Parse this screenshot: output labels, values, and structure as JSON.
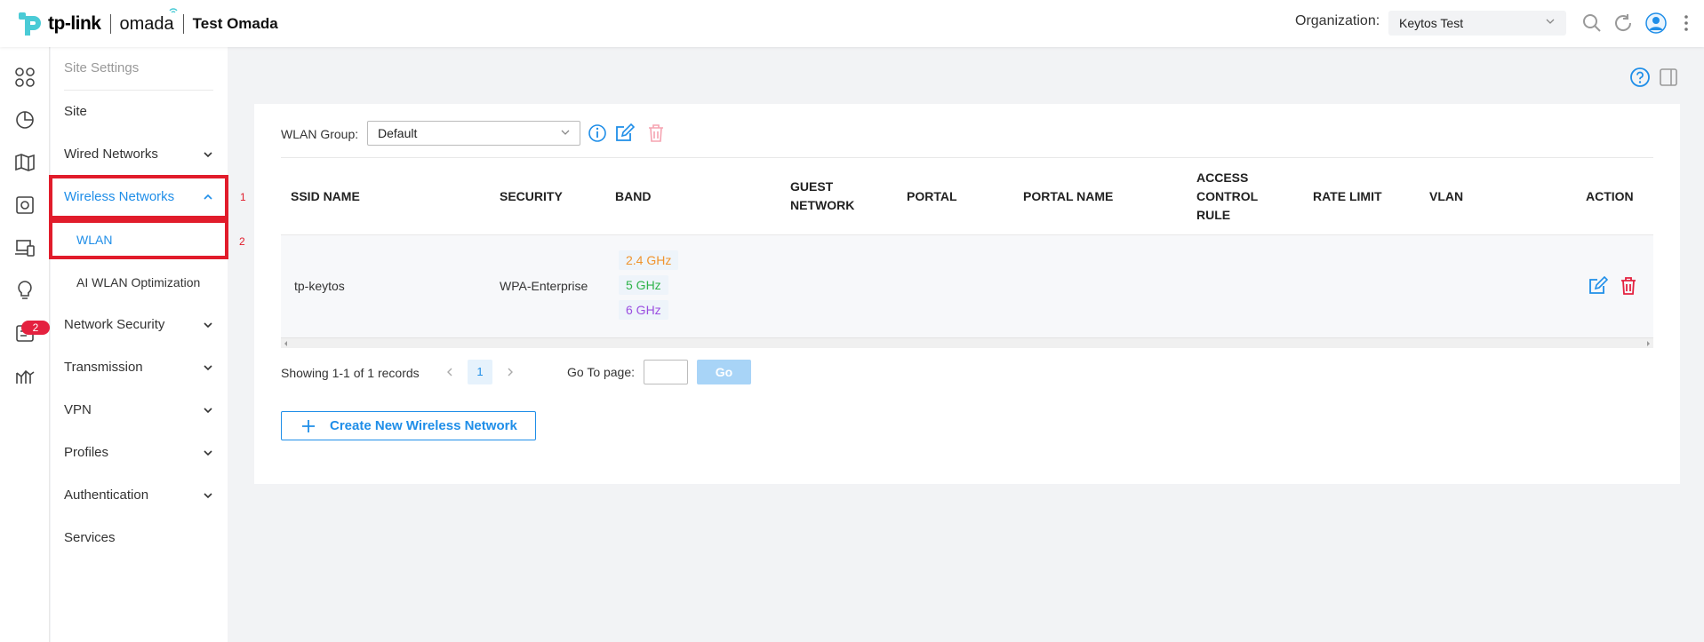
{
  "header": {
    "brand": "tp-link",
    "product": "omada",
    "app_title": "Test Omada",
    "org_label": "Organization:",
    "org_value": "Keytos Test"
  },
  "rail": {
    "badge_count": "2",
    "icons": [
      "dashboard-icon",
      "statistics-icon",
      "map-icon",
      "devices-icon",
      "clients-icon",
      "insights-icon",
      "logs-icon",
      "reports-icon"
    ]
  },
  "sidebar": {
    "heading": "Site Settings",
    "items": [
      {
        "label": "Site"
      },
      {
        "label": "Wired Networks"
      },
      {
        "label": "Wireless Networks"
      },
      {
        "label": "WLAN"
      },
      {
        "label": "AI WLAN Optimization"
      },
      {
        "label": "Network Security"
      },
      {
        "label": "Transmission"
      },
      {
        "label": "VPN"
      },
      {
        "label": "Profiles"
      },
      {
        "label": "Authentication"
      },
      {
        "label": "Services"
      }
    ],
    "annotations": [
      "1",
      "2"
    ]
  },
  "wlan_group": {
    "label": "WLAN Group",
    "selected": "Default"
  },
  "table": {
    "columns": {
      "ssid": "SSID NAME",
      "security": "SECURITY",
      "band": "BAND",
      "guest_1": "GUEST",
      "guest_2": "NETWORK",
      "portal": "PORTAL",
      "portal_name": "PORTAL NAME",
      "acr_1": "ACCESS",
      "acr_2": "CONTROL",
      "acr_3": "RULE",
      "rate_limit": "RATE LIMIT",
      "vlan": "VLAN",
      "action": "ACTION"
    },
    "rows": [
      {
        "ssid": "tp-keytos",
        "security": "WPA-Enterprise",
        "bands": [
          "2.4 GHz",
          "5 GHz",
          "6 GHz"
        ]
      }
    ]
  },
  "pagination": {
    "summary": "Showing 1-1 of 1 records",
    "current_page": "1",
    "goto_label": "Go To page:",
    "go_label": "Go"
  },
  "create_button": "Create New Wireless Network",
  "colors": {
    "accent": "#1f8ee8",
    "danger": "#e4213f",
    "band_24": "#f0942d",
    "band_5": "#2fb34a",
    "band_6": "#9b4ee0"
  }
}
